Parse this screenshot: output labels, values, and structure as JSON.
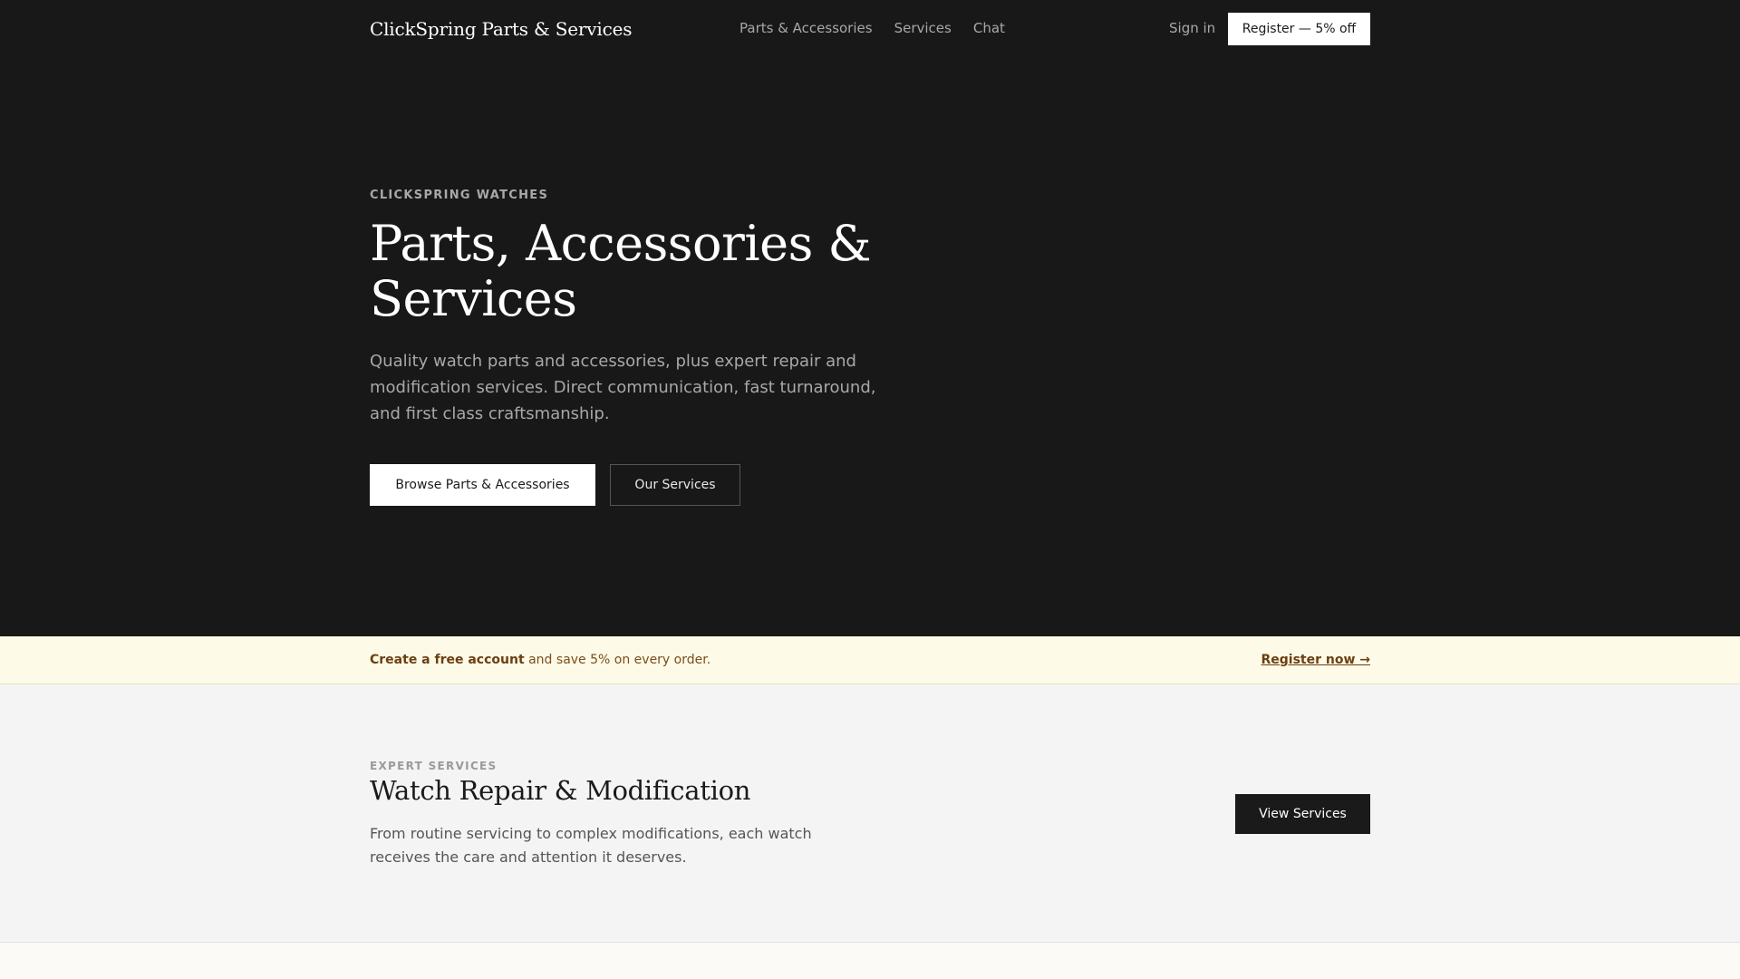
{
  "nav": {
    "brand": "ClickSpring Parts & Services",
    "links": [
      "Parts & Accessories",
      "Services",
      "Chat"
    ],
    "signin": "Sign in",
    "register": "Register — 5% off"
  },
  "hero": {
    "eyebrow": "CLICKSPRING WATCHES",
    "title": "Parts, Accessories & Services",
    "description": "Quality watch parts and accessories, plus expert repair and modification services. Direct communication, fast turnaround, and first class craftsmanship.",
    "primary_button": "Browse Parts & Accessories",
    "secondary_button": "Our Services"
  },
  "banner": {
    "bold_text": "Create a free account",
    "text": " and save 5% on every order.",
    "link": "Register now →"
  },
  "services": {
    "eyebrow": "EXPERT SERVICES",
    "title": "Watch Repair & Modification",
    "description": "From routine servicing to complex modifications, each watch receives the care and attention it deserves.",
    "button": "View Services"
  }
}
